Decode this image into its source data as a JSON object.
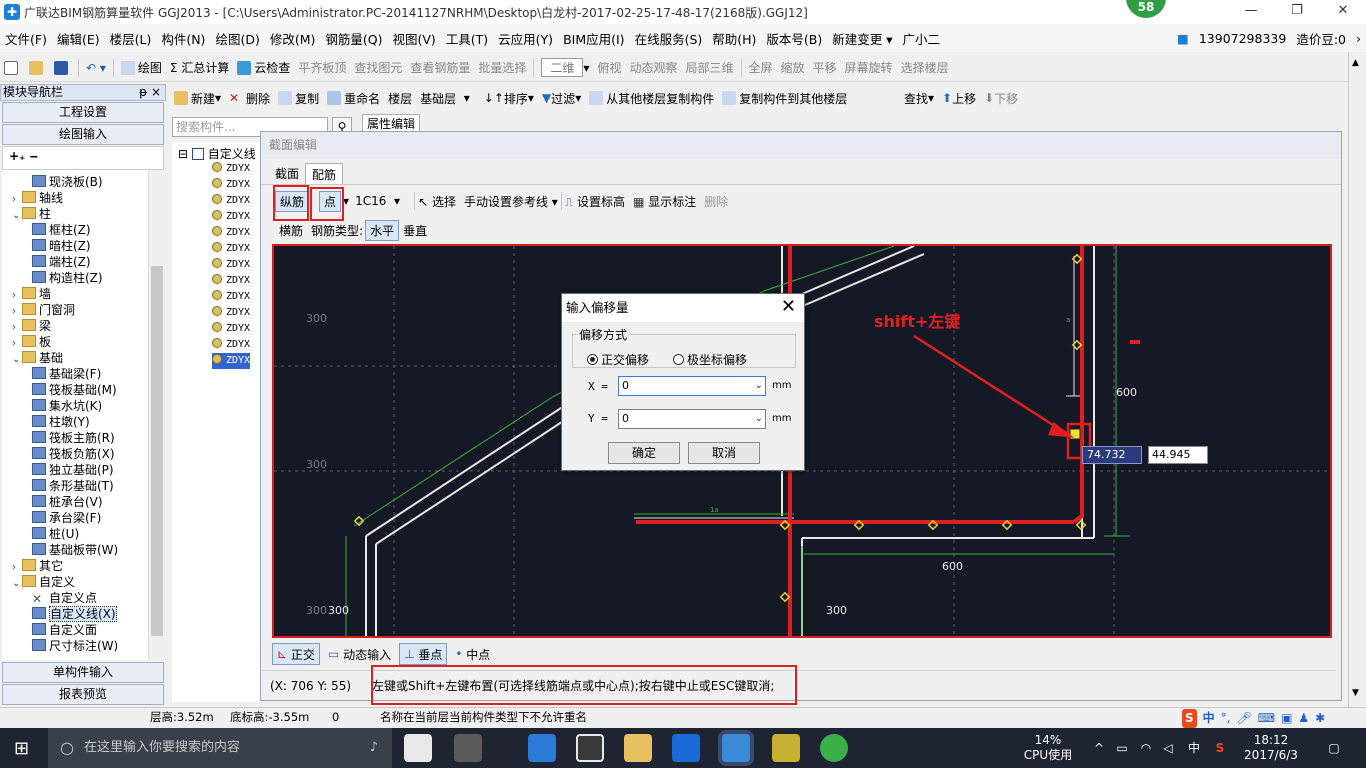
{
  "titlebar": {
    "title": "广联达BIM钢筋算量软件 GGJ2013 - [C:\\Users\\Administrator.PC-20141127NRHM\\Desktop\\白龙村-2017-02-25-17-48-17(2168版).GGJ12]",
    "badge": "58"
  },
  "menubar": {
    "items": [
      "文件(F)",
      "编辑(E)",
      "楼层(L)",
      "构件(N)",
      "绘图(D)",
      "修改(M)",
      "钢筋量(Q)",
      "视图(V)",
      "工具(T)",
      "云应用(Y)",
      "BIM应用(I)",
      "在线服务(S)",
      "帮助(H)",
      "版本号(B)",
      "新建变更 ▾",
      "广小二"
    ],
    "phone": "13907298339",
    "price": "造价豆:0"
  },
  "toolbar1": {
    "items": [
      "绘图",
      "Σ 汇总计算",
      "云检查",
      "平齐板顶",
      "查找图元",
      "查看钢筋量",
      "批量选择",
      "二维",
      "俯视",
      "动态观察",
      "局部三维",
      "全屏",
      "缩放",
      "平移",
      "屏幕旋转",
      "选择楼层"
    ]
  },
  "nav": {
    "header": "模块导航栏",
    "buttons": [
      "工程设置",
      "绘图输入",
      "单构件输入",
      "报表预览"
    ],
    "tree": [
      "现浇板(B)",
      "轴线",
      "柱",
      "框柱(Z)",
      "暗柱(Z)",
      "端柱(Z)",
      "构造柱(Z)",
      "墙",
      "门窗洞",
      "梁",
      "板",
      "基础",
      "基础梁(F)",
      "筏板基础(M)",
      "集水坑(K)",
      "柱墩(Y)",
      "筏板主筋(R)",
      "筏板负筋(X)",
      "独立基础(P)",
      "条形基础(T)",
      "桩承台(V)",
      "承台梁(F)",
      "桩(U)",
      "基础板带(W)",
      "其它",
      "自定义",
      "自定义点",
      "自定义线(X)",
      "自定义面",
      "尺寸标注(W)"
    ]
  },
  "midtoolbar": {
    "items": [
      "新建",
      "删除",
      "复制",
      "重命名",
      "楼层",
      "基础层",
      "排序",
      "过滤",
      "从其他楼层复制构件",
      "复制构件到其他楼层",
      "查找",
      "上移",
      "下移"
    ]
  },
  "search": {
    "placeholder": "搜索构件..."
  },
  "complist": {
    "root": "自定义线",
    "items": [
      "ZDYX",
      "ZDYX",
      "ZDYX",
      "ZDYX",
      "ZDYX",
      "ZDYX",
      "ZDYX",
      "ZDYX",
      "ZDYX",
      "ZDYX",
      "ZDYX",
      "ZDYX",
      "ZDYX"
    ]
  },
  "proptab": "属性编辑",
  "section": {
    "caption": "截面编辑",
    "tabs": [
      "截面",
      "配筋"
    ],
    "tb1": {
      "zongjin": "纵筋",
      "dian": "点",
      "bar": "1C16",
      "select": "选择",
      "manual": "手动设置参考线",
      "setheight": "设置标高",
      "showmark": "显示标注",
      "delete": "删除"
    },
    "tb2": {
      "hengjin": "横筋",
      "type": "钢筋类型:",
      "horizontal": "水平",
      "vertical": "垂直"
    },
    "canvas": {
      "dims": [
        "300",
        "300",
        "300",
        "300",
        "600",
        "600",
        "1a",
        "a"
      ],
      "annotation": "shift+左键",
      "coord_x": "74.732",
      "coord_y": "44.945"
    },
    "bottom": [
      "正交",
      "动态输入",
      "垂点",
      "中点"
    ],
    "status_coord": "(X: 706 Y: 55)",
    "status_hint": "左键或Shift+左键布置(可选择线筋端点或中心点);按右键中止或ESC键取消;"
  },
  "dialog": {
    "title": "输入偏移量",
    "group": "偏移方式",
    "opt1": "正交偏移",
    "opt2": "极坐标偏移",
    "xlabel": "X =",
    "ylabel": "Y =",
    "xvalue": "0",
    "yvalue": "0",
    "unit": "mm",
    "ok": "确定",
    "cancel": "取消"
  },
  "appstatus": {
    "floor_height": "层高:3.52m",
    "bottom_height": "底标高:-3.55m",
    "zero": "0",
    "message": "名称在当前层当前构件类型下不允许重名"
  },
  "taskbar": {
    "search_placeholder": "在这里输入你要搜索的内容",
    "cpu_pct": "14%",
    "cpu_label": "CPU使用",
    "ime": "中",
    "time": "18:12",
    "date": "2017/6/3"
  },
  "colors": {
    "accent": "#1e7fd6",
    "highlight_red": "#e02020",
    "canvas_bg": "#141925"
  }
}
